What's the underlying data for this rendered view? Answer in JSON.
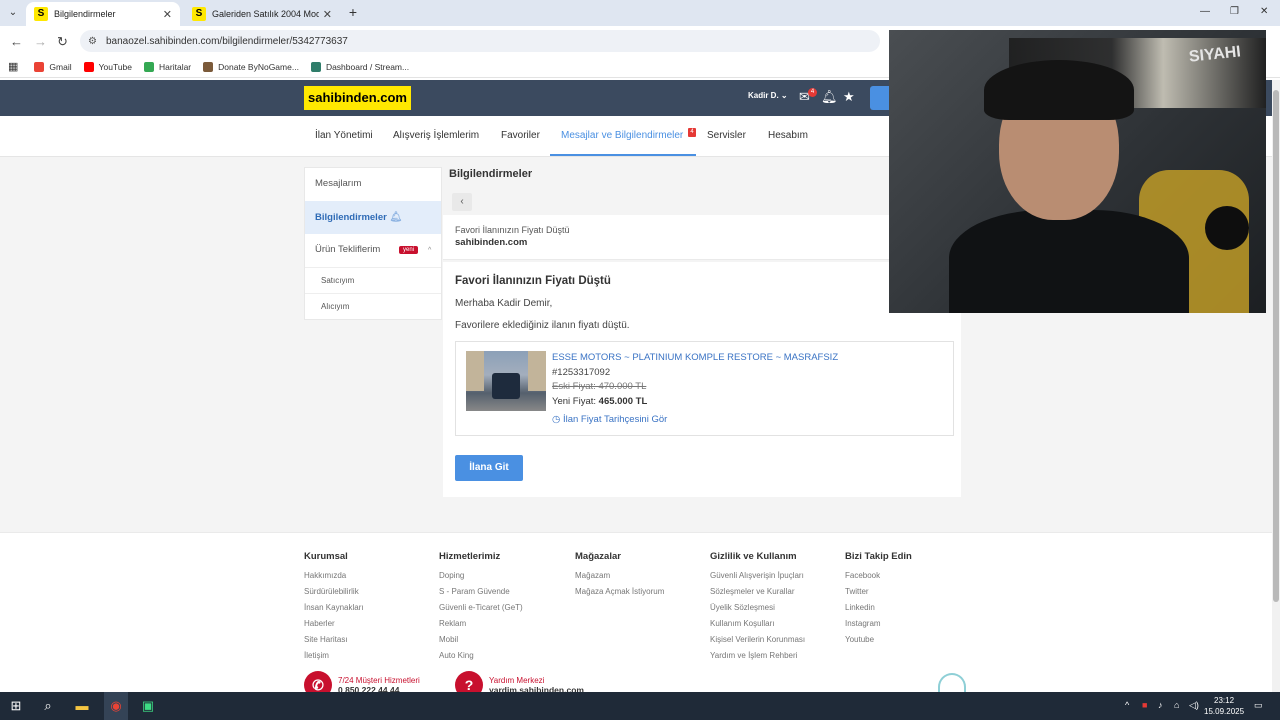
{
  "browser": {
    "tabs": [
      {
        "favicon": "S",
        "title": "Bilgilendirmeler",
        "active": true
      },
      {
        "favicon": "S",
        "title": "Galeriden Satılık 2004 Model K",
        "active": false
      }
    ],
    "url": "banaozel.sahibinden.com/bilgilendirmeler/5342773637",
    "bookmarks": [
      "Gmail",
      "YouTube",
      "Haritalar",
      "Donate ByNoGame...",
      "Dashboard / Stream..."
    ]
  },
  "header": {
    "logo": "sahibinden.com",
    "user": "Kadir D.",
    "message_count": "4",
    "nav": [
      "İlan Yönetimi",
      "Alışveriş İşlemlerim",
      "Favoriler",
      "Mesajlar ve Bilgilendirmeler",
      "Servisler",
      "Hesabım"
    ],
    "nav_badge": "4"
  },
  "sidebar": {
    "items": [
      "Mesajlarım",
      "Bilgilendirmeler",
      "Ürün Tekliflerim"
    ],
    "yeni": "yeni",
    "sub": [
      "Satıcıyım",
      "Alıcıyım"
    ]
  },
  "panel": {
    "title": "Bilgilendirmeler",
    "subject": "Favori İlanınızın Fiyatı Düştü",
    "from": "sahibinden.com"
  },
  "message": {
    "heading": "Favori İlanınızın Fiyatı Düştü",
    "greeting": "Merhaba Kadir Demir,",
    "text": "Favorilere eklediğiniz ilanın fiyatı düştü.",
    "listing": {
      "title": "ESSE MOTORS ~ PLATINIUM KOMPLE RESTORE ~ MASRAFSIZ",
      "id": "#1253317092",
      "old_price": "Eski Fiyat: 470.000 TL",
      "new_price_label": "Yeni Fiyat:",
      "new_price": "465.000 TL",
      "history_link": "İlan Fiyat Tarihçesini Gör"
    },
    "button": "İlana Git"
  },
  "webcam": {
    "banner_text": "SIYAHI"
  },
  "footer": {
    "columns": [
      {
        "title": "Kurumsal",
        "links": [
          "Hakkımızda",
          "Sürdürülebilirlik",
          "İnsan Kaynakları",
          "Haberler",
          "Site Haritası",
          "İletişim"
        ]
      },
      {
        "title": "Hizmetlerimiz",
        "links": [
          "Doping",
          "S - Param Güvende",
          "Güvenli e-Ticaret (GeT)",
          "Reklam",
          "Mobil",
          "Auto King"
        ]
      },
      {
        "title": "Mağazalar",
        "links": [
          "Mağazam",
          "Mağaza Açmak İstiyorum"
        ]
      },
      {
        "title": "Gizlilik ve Kullanım",
        "links": [
          "Güvenli Alışverişin İpuçları",
          "Sözleşmeler ve Kurallar",
          "Üyelik Sözleşmesi",
          "Kullanım Koşulları",
          "Kişisel Verilerin Korunması",
          "Yardım ve İşlem Rehberi"
        ]
      },
      {
        "title": "Bizi Takip Edin",
        "links": [
          "Facebook",
          "Twitter",
          "Linkedin",
          "Instagram",
          "Youtube"
        ]
      }
    ],
    "contact1": {
      "line1": "7/24 Müşteri Hizmetleri",
      "line2": "0 850 222 44 44"
    },
    "contact2": {
      "line1": "Yardım Merkezi",
      "line2": "yardim.sahibinden.com"
    }
  },
  "taskbar": {
    "time": "23:12",
    "date": "15.09.2025"
  }
}
